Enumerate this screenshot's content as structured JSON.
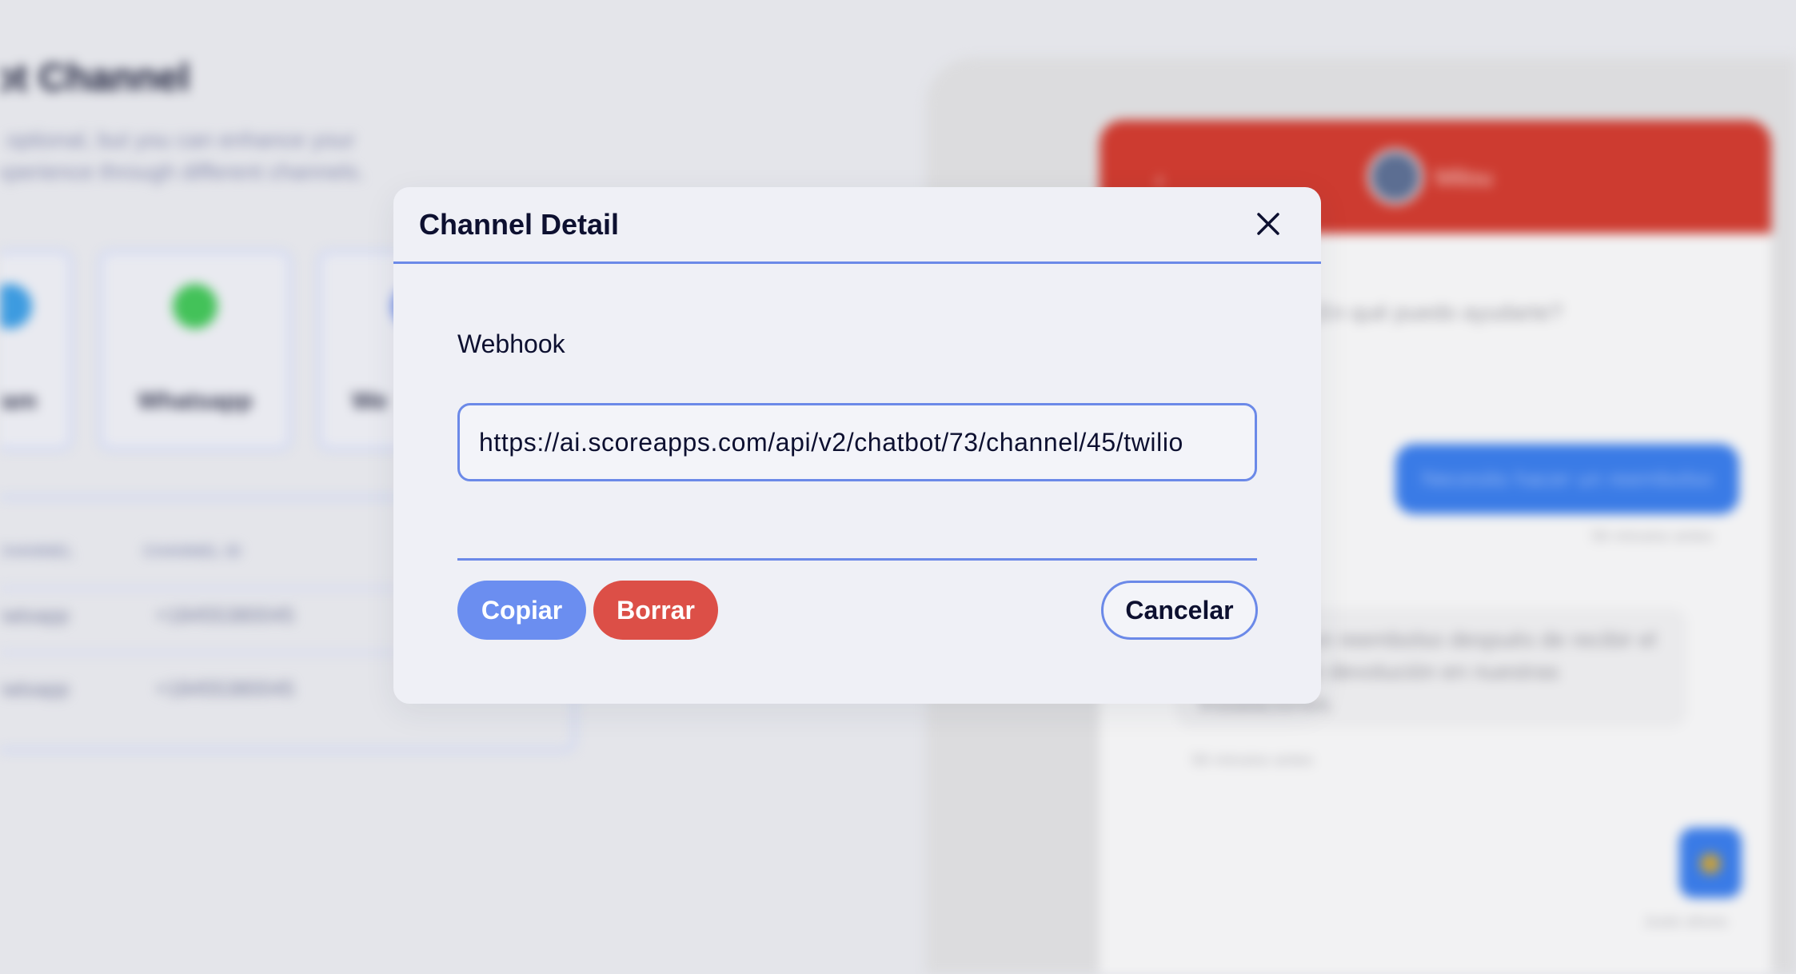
{
  "background": {
    "page_title": "bot Channel",
    "page_description": "is optional, but you can enhance your experience through different channels.",
    "channel_cards": [
      {
        "label": "ram",
        "icon": "telegram-icon",
        "color": "#3d9be0"
      },
      {
        "label": "Whatsapp",
        "icon": "whatsapp-icon",
        "color": "#43c259"
      },
      {
        "label": "We",
        "icon": "web-icon",
        "color": "#6b89e8"
      }
    ],
    "table": {
      "headers": [
        "CHANNEL",
        "CHANNEL ID"
      ],
      "rows": [
        [
          "hatsapp",
          "+18455380045"
        ],
        [
          "hatsapp",
          "+18455380045"
        ]
      ]
    },
    "chat": {
      "bot_name": "Milou",
      "greeting": "¿En qué puedo ayudarte?",
      "user_message": "Necesito hacer un reembolso",
      "user_time": "56 minutos antes",
      "bot_reply": "Procesaré un reembolso después de recibir el elemento de devolución en nuestras instalaciones.",
      "bot_time": "56 minutos antes",
      "fab_caption": "Justo ahora",
      "header_color": "#cd3b30"
    }
  },
  "modal": {
    "title": "Channel Detail",
    "close_icon": "close-icon",
    "webhook_label": "Webhook",
    "webhook_value": "https://ai.scoreapps.com/api/v2/chatbot/73/channel/45/twilio",
    "buttons": {
      "copy": "Copiar",
      "delete": "Borrar",
      "cancel": "Cancelar"
    },
    "colors": {
      "accent": "#6b89e8",
      "copy_button": "#6b8ef0",
      "delete_button": "#dc4f47",
      "modal_background": "#eff0f6"
    }
  }
}
